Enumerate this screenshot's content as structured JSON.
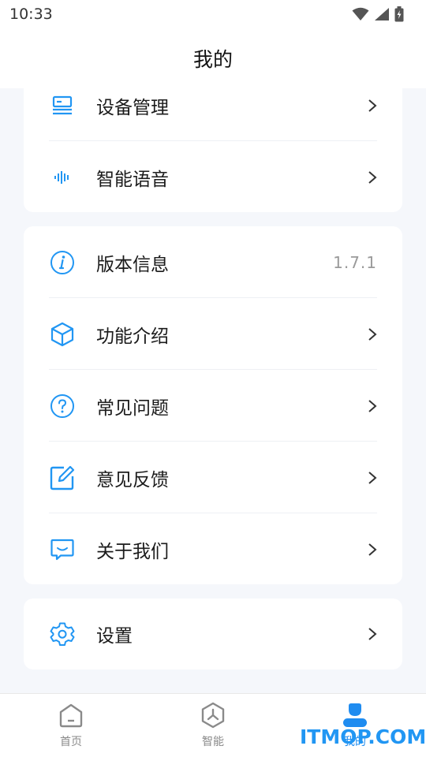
{
  "status_bar": {
    "time": "10:33"
  },
  "header": {
    "title": "我的"
  },
  "card1": {
    "items": [
      {
        "label": "设备管理",
        "icon": "device-icon"
      },
      {
        "label": "智能语音",
        "icon": "voice-wave-icon"
      }
    ]
  },
  "card2": {
    "items": [
      {
        "label": "版本信息",
        "icon": "info-icon",
        "value": "1.7.1"
      },
      {
        "label": "功能介绍",
        "icon": "cube-icon"
      },
      {
        "label": "常见问题",
        "icon": "question-icon"
      },
      {
        "label": "意见反馈",
        "icon": "edit-icon"
      },
      {
        "label": "关于我们",
        "icon": "message-icon"
      }
    ]
  },
  "card3": {
    "items": [
      {
        "label": "设置",
        "icon": "gear-icon"
      }
    ]
  },
  "tabbar": {
    "tabs": [
      {
        "label": "首页",
        "icon": "home-icon"
      },
      {
        "label": "智能",
        "icon": "smart-hex-icon"
      },
      {
        "label": "我的",
        "icon": "user-icon"
      }
    ]
  },
  "watermark": "ITMOP.COM",
  "colors": {
    "accent": "#1f8cf0",
    "background": "#f5f7fb"
  }
}
